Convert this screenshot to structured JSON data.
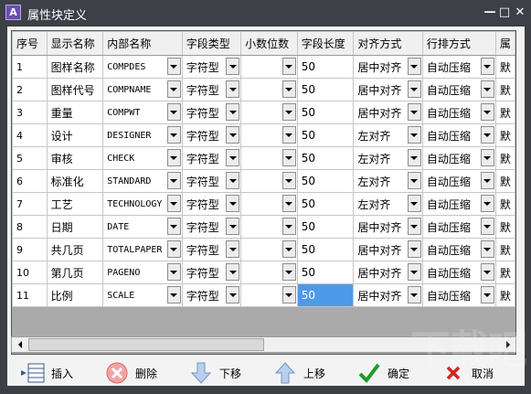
{
  "window": {
    "title": "属性块定义",
    "app_icon_glyph": "A",
    "minimize_glyph": "—",
    "maximize_glyph": "□",
    "close_glyph": "✕"
  },
  "columns": [
    "序号",
    "显示名称",
    "内部名称",
    "字段类型",
    "小数位数",
    "字段长度",
    "对齐方式",
    "行排方式",
    "属"
  ],
  "rows": [
    {
      "seq": "1",
      "display": "图样名称",
      "internal": "COMPDES",
      "type": "字符型",
      "decimals": "",
      "length": "50",
      "align": "居中对齐",
      "wrap": "自动压缩",
      "extra": "默"
    },
    {
      "seq": "2",
      "display": "图样代号",
      "internal": "COMPNAME",
      "type": "字符型",
      "decimals": "",
      "length": "50",
      "align": "居中对齐",
      "wrap": "自动压缩",
      "extra": "默"
    },
    {
      "seq": "3",
      "display": "重量",
      "internal": "COMPWT",
      "type": "字符型",
      "decimals": "",
      "length": "50",
      "align": "居中对齐",
      "wrap": "自动压缩",
      "extra": "默"
    },
    {
      "seq": "4",
      "display": "设计",
      "internal": "DESIGNER",
      "type": "字符型",
      "decimals": "",
      "length": "50",
      "align": "左对齐",
      "wrap": "自动压缩",
      "extra": "默"
    },
    {
      "seq": "5",
      "display": "审核",
      "internal": "CHECK",
      "type": "字符型",
      "decimals": "",
      "length": "50",
      "align": "左对齐",
      "wrap": "自动压缩",
      "extra": "默"
    },
    {
      "seq": "6",
      "display": "标准化",
      "internal": "STANDARD",
      "type": "字符型",
      "decimals": "",
      "length": "50",
      "align": "左对齐",
      "wrap": "自动压缩",
      "extra": "默"
    },
    {
      "seq": "7",
      "display": "工艺",
      "internal": "TECHNOLOGY",
      "type": "字符型",
      "decimals": "",
      "length": "50",
      "align": "左对齐",
      "wrap": "自动压缩",
      "extra": "默"
    },
    {
      "seq": "8",
      "display": "日期",
      "internal": "DATE",
      "type": "字符型",
      "decimals": "",
      "length": "50",
      "align": "居中对齐",
      "wrap": "自动压缩",
      "extra": "默"
    },
    {
      "seq": "9",
      "display": "共几页",
      "internal": "TOTALPAPER",
      "type": "字符型",
      "decimals": "",
      "length": "50",
      "align": "居中对齐",
      "wrap": "自动压缩",
      "extra": "默"
    },
    {
      "seq": "10",
      "display": "第几页",
      "internal": "PAGENO",
      "type": "字符型",
      "decimals": "",
      "length": "50",
      "align": "居中对齐",
      "wrap": "自动压缩",
      "extra": "默"
    },
    {
      "seq": "11",
      "display": "比例",
      "internal": "SCALE",
      "type": "字符型",
      "decimals": "",
      "length": "50",
      "align": "居中对齐",
      "wrap": "自动压缩",
      "extra": "默"
    }
  ],
  "selected_row": 10,
  "toolbar": {
    "insert": "插入",
    "delete": "删除",
    "move_down": "下移",
    "move_up": "上移",
    "ok": "确定",
    "cancel": "取消"
  },
  "icons": {
    "insert": "insert-rows-icon",
    "delete": "delete-x-circle-icon",
    "move_down": "arrow-down-icon",
    "move_up": "arrow-up-icon",
    "ok": "green-check-icon",
    "cancel": "red-x-icon"
  },
  "colors": {
    "titlebar": "#3d4047",
    "selection": "#4c9be8",
    "grid_empty": "#aaaaaa"
  },
  "watermark": "下载吧"
}
